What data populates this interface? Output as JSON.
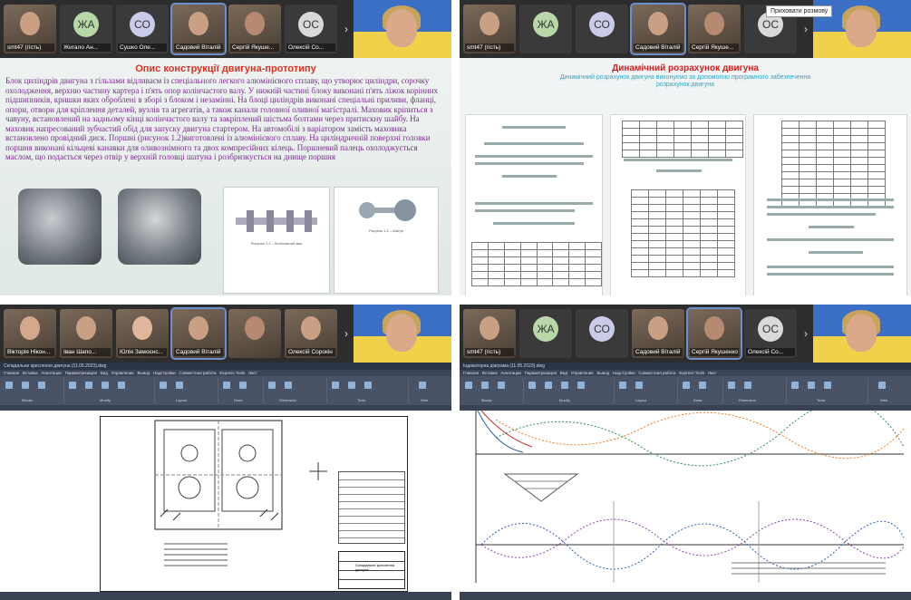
{
  "q1": {
    "participants": [
      {
        "name": "smt47 (гість)"
      },
      {
        "name": "Жигало Ан...",
        "initials": "ЖА",
        "color": "#b9d8a8"
      },
      {
        "name": "Сушко Оле...",
        "initials": "СО",
        "color": "#c9cbe8"
      },
      {
        "name": "Садовий Віталій"
      },
      {
        "name": "Сергій Якуше..."
      },
      {
        "name": "Олексій Со...",
        "initials": "ОС",
        "color": "#d9d9d9"
      }
    ],
    "slide": {
      "title": "Опис конструкції двигуна-прототипу",
      "body": "Блок циліндрів двигуна з гільзами відливаєм із спеціального легкого алюмінієвого сплаву, що утворює циліндри, сорочку охолодження, верхню частину картера і п'ять опор колінчастого валу. У нижній частині блоку виконані п'ять ліжок корінних підшипників, кришки яких оброблені в зборі з блоком і незамінні. На блоці циліндрів виконані спеціальні приливи, фланці, опори, отвори для кріплення деталей, вузлів та агрегатів, а також канали головної оливної магістралі. Маховик кріпиться з чавуну, встановлений на задньому кінці колінчастого валу та закріплений шістьма болтами через притискну шайбу. На маховик напресований зубчастий обід для запуску двигуна стартером. На автомобілі з варіатором замість маховика встановлено провідний диск. Поршні (рисунок 1.2)виготовлені із алюмінієвого сплаву. На циліндричній поверхні головки поршня виконані кільцеві канавки для оливознімного та двох компресійних кілець. Поршневий палець охолоджується маслом, що подається через отвір у верхній головці шатуна і розбризкується на днище поршня",
      "doc_caption_1": "Рисунок 1.1 – Колінчастий вал",
      "doc_caption_2": "Рисунок 1.2 – Шатун"
    }
  },
  "q2": {
    "participants": [
      {
        "name": "smt47 (гість)"
      },
      {
        "name": "",
        "initials": "ЖА",
        "color": "#b9d8a8"
      },
      {
        "name": "",
        "initials": "СО",
        "color": "#c9cbe8"
      },
      {
        "name": "Садовий Віталій"
      },
      {
        "name": "Сергій Якуше..."
      },
      {
        "name": "",
        "initials": "ОС",
        "color": "#d9d9d9"
      }
    ],
    "tooltip": "Приховати розмову",
    "slide": {
      "title": "Динамічний розрахунок двигуна",
      "subtitle": "Динамічний розрахунок двигуна виконуємо за допомогою програмного забезпечення розрахунок двигуна"
    }
  },
  "q3": {
    "participants": [
      {
        "name": "Вікторія Нікон..."
      },
      {
        "name": "Іван Шапо..."
      },
      {
        "name": "Юлія Замоєнс..."
      },
      {
        "name": "Садовий Віталій"
      },
      {
        "name": ""
      },
      {
        "name": "Олексій Сорокін"
      }
    ],
    "cad": {
      "window_title": "Складальне креслення двигуна (11.05.2023).dwg",
      "menu": [
        "Главная",
        "Вставка",
        "Аннотации",
        "Параметризация",
        "Вид",
        "Управление",
        "Вывод",
        "Надстройки",
        "Совместная работа",
        "Express Tools",
        "Лист"
      ],
      "groups": [
        "Blocks",
        "Modify",
        "Layout",
        "Draw",
        "Dimension",
        "Tools",
        "Web"
      ],
      "title_block_label": "Складальне креслення двигуна"
    }
  },
  "q4": {
    "participants": [
      {
        "name": "smt47 (гість)"
      },
      {
        "name": "",
        "initials": "ЖА",
        "color": "#b9d8a8"
      },
      {
        "name": "",
        "initials": "СО",
        "color": "#c9cbe8"
      },
      {
        "name": "Садовий Віталій"
      },
      {
        "name": "Сергій Якушенко"
      },
      {
        "name": "Олексій Со...",
        "initials": "ОС",
        "color": "#d9d9d9"
      }
    ],
    "cad": {
      "window_title": "Індикаторна діаграма (11.05.2023).dwg",
      "menu": [
        "Главная",
        "Вставка",
        "Аннотации",
        "Параметризация",
        "Вид",
        "Управление",
        "Вывод",
        "Надстройки",
        "Совместная работа",
        "Express Tools",
        "Лист"
      ],
      "groups": [
        "Blocks",
        "Modify",
        "Layout",
        "Draw",
        "Dimension",
        "Tools",
        "Web"
      ]
    }
  }
}
